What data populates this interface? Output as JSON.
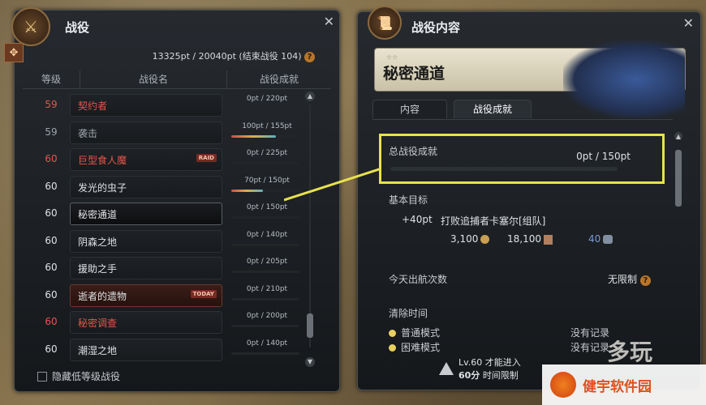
{
  "left_panel": {
    "title": "战役",
    "points_text": "13325pt / 20040pt (结束战役 104)",
    "columns": {
      "level": "等级",
      "name": "战役名",
      "achievement": "战役成就"
    },
    "rows": [
      {
        "level": "59",
        "name": "契约者",
        "pt": "0pt / 220pt",
        "progress": 0,
        "color": "red"
      },
      {
        "level": "59",
        "name": "袭击",
        "pt": "100pt / 155pt",
        "progress": 0.65,
        "color": "gray"
      },
      {
        "level": "60",
        "name": "巨型食人魔",
        "pt": "0pt / 225pt",
        "progress": 0,
        "color": "red",
        "tag": "RAID"
      },
      {
        "level": "60",
        "name": "发光的虫子",
        "pt": "70pt / 150pt",
        "progress": 0.47,
        "color": "white"
      },
      {
        "level": "60",
        "name": "秘密通道",
        "pt": "0pt / 150pt",
        "progress": 0,
        "color": "white",
        "selected": true
      },
      {
        "level": "60",
        "name": "阴森之地",
        "pt": "0pt / 140pt",
        "progress": 0,
        "color": "white"
      },
      {
        "level": "60",
        "name": "援助之手",
        "pt": "0pt / 205pt",
        "progress": 0,
        "color": "white"
      },
      {
        "level": "60",
        "name": "逝者的遗物",
        "pt": "0pt / 210pt",
        "progress": 0,
        "color": "white",
        "tag": "TODAY"
      },
      {
        "level": "60",
        "name": "秘密调查",
        "pt": "0pt / 200pt",
        "progress": 0,
        "color": "red"
      },
      {
        "level": "60",
        "name": "潮湿之地",
        "pt": "0pt / 140pt",
        "progress": 0,
        "color": "white"
      }
    ],
    "hide_low_level_label": "隐藏低等级战役"
  },
  "right_panel": {
    "title": "战役内容",
    "campaign_name": "秘密通道",
    "stars": "☆☆",
    "tabs": [
      "内容",
      "战役成就"
    ],
    "active_tab": 1,
    "total_achievement_label": "总战役成就",
    "total_achievement_value": "0pt / 150pt",
    "basic_goal_label": "基本目标",
    "goal_pt": "+40pt",
    "goal_text": "打败追捕者卡塞尔[组队]",
    "reward_gold": "3,100",
    "reward_badge": "18,100",
    "reward_wings": "40",
    "daily_runs_label": "今天出航次数",
    "daily_runs_value": "无限制",
    "clear_time_label": "清除时间",
    "modes": [
      {
        "name": "普通模式",
        "record": "没有记录"
      },
      {
        "name": "困难模式",
        "record": "没有记录"
      }
    ],
    "req_line1": "Lv.60 才能进入",
    "req_level": "60分",
    "req_time": "时间限制"
  },
  "watermark": {
    "text1": "多玩",
    "text2": "健宇软件园"
  },
  "colors": {
    "red": "#e2574a",
    "highlight": "#e8e24c"
  }
}
